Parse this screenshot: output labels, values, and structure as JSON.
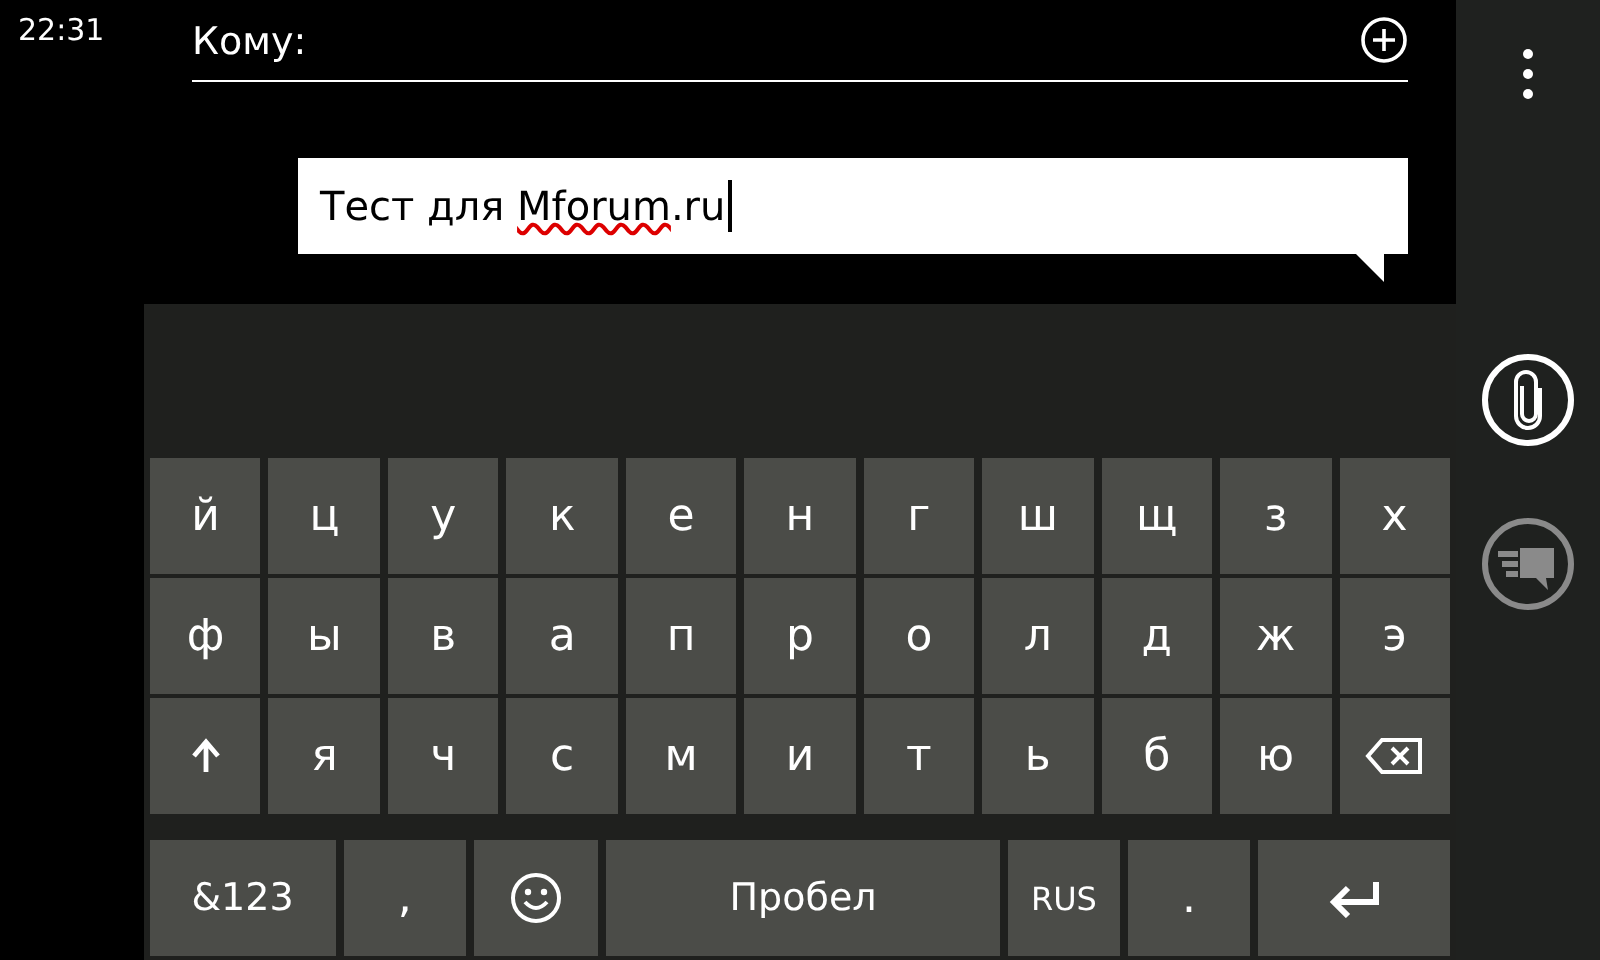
{
  "status_bar": {
    "time": "22:31"
  },
  "compose": {
    "to_label": "Кому:",
    "message": [
      {
        "text": "Тест для ",
        "misspelled": false
      },
      {
        "text": "Mforum",
        "misspelled": true
      },
      {
        "text": ".ru",
        "misspelled": false
      }
    ]
  },
  "keyboard": {
    "letter_rows": [
      [
        {
          "kind": "char",
          "label": "й"
        },
        {
          "kind": "char",
          "label": "ц"
        },
        {
          "kind": "char",
          "label": "у"
        },
        {
          "kind": "char",
          "label": "к"
        },
        {
          "kind": "char",
          "label": "е"
        },
        {
          "kind": "char",
          "label": "н"
        },
        {
          "kind": "char",
          "label": "г"
        },
        {
          "kind": "char",
          "label": "ш"
        },
        {
          "kind": "char",
          "label": "щ"
        },
        {
          "kind": "char",
          "label": "з"
        },
        {
          "kind": "char",
          "label": "х"
        }
      ],
      [
        {
          "kind": "char",
          "label": "ф"
        },
        {
          "kind": "char",
          "label": "ы"
        },
        {
          "kind": "char",
          "label": "в"
        },
        {
          "kind": "char",
          "label": "а"
        },
        {
          "kind": "char",
          "label": "п"
        },
        {
          "kind": "char",
          "label": "р"
        },
        {
          "kind": "char",
          "label": "о"
        },
        {
          "kind": "char",
          "label": "л"
        },
        {
          "kind": "char",
          "label": "д"
        },
        {
          "kind": "char",
          "label": "ж"
        },
        {
          "kind": "char",
          "label": "э"
        }
      ],
      [
        {
          "kind": "shift"
        },
        {
          "kind": "char",
          "label": "я"
        },
        {
          "kind": "char",
          "label": "ч"
        },
        {
          "kind": "char",
          "label": "с"
        },
        {
          "kind": "char",
          "label": "м"
        },
        {
          "kind": "char",
          "label": "и"
        },
        {
          "kind": "char",
          "label": "т"
        },
        {
          "kind": "char",
          "label": "ь"
        },
        {
          "kind": "char",
          "label": "б"
        },
        {
          "kind": "char",
          "label": "ю"
        },
        {
          "kind": "backspace"
        }
      ]
    ],
    "bottom_row": [
      {
        "kind": "wide",
        "label": "&123"
      },
      {
        "kind": "char",
        "label": ","
      },
      {
        "kind": "emoji"
      },
      {
        "kind": "space",
        "label": "Пробел"
      },
      {
        "kind": "small",
        "label": "RUS"
      },
      {
        "kind": "char",
        "label": "."
      },
      {
        "kind": "enter"
      }
    ]
  },
  "app_bar": [
    {
      "kind": "attach",
      "disabled": false
    },
    {
      "kind": "send",
      "disabled": true
    }
  ]
}
